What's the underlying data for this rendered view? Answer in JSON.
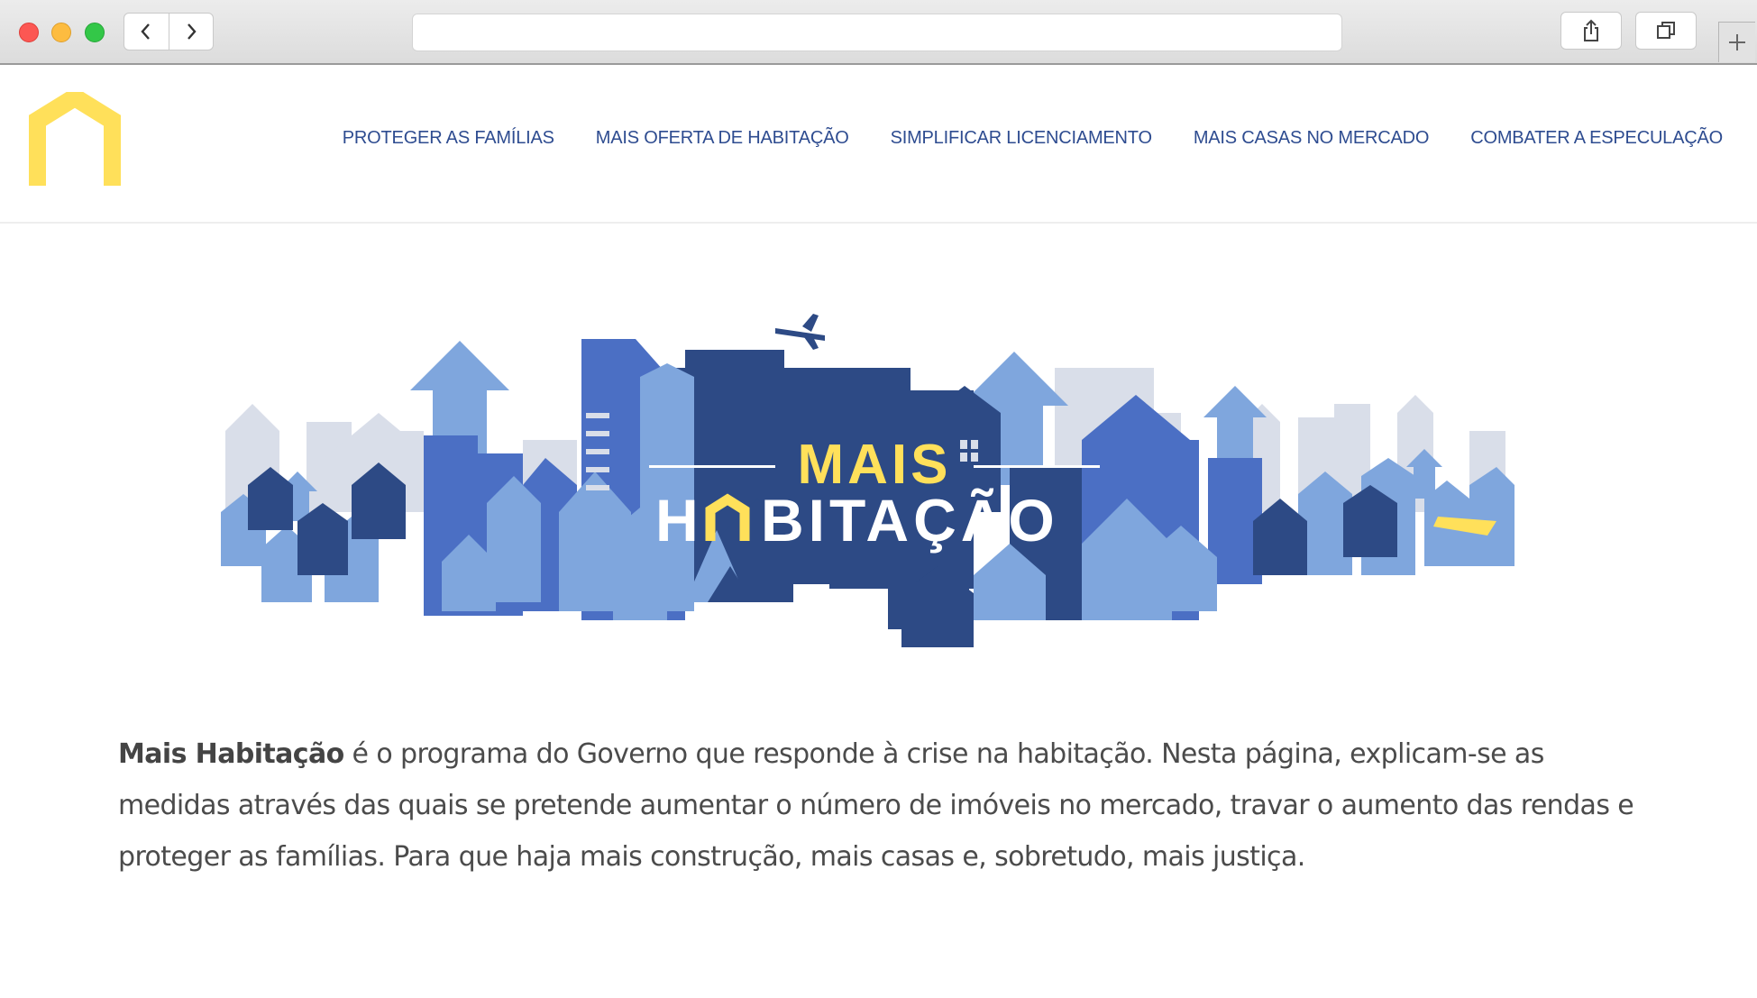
{
  "browser": {
    "url": "",
    "back_icon": "chevron-left-icon",
    "forward_icon": "chevron-right-icon",
    "share_icon": "share-icon",
    "tabs_icon": "tabs-icon",
    "new_tab_icon": "plus-icon"
  },
  "site": {
    "logo_icon": "house-outline-icon",
    "nav": [
      {
        "label": "PROTEGER AS FAMÍLIAS"
      },
      {
        "label": "MAIS OFERTA DE HABITAÇÃO"
      },
      {
        "label": "SIMPLIFICAR LICENCIAMENTO"
      },
      {
        "label": "MAIS CASAS NO MERCADO"
      },
      {
        "label": "COMBATER A ESPECULAÇÃO"
      }
    ]
  },
  "hero": {
    "title_line1": "MAIS",
    "title_line2_rest": "BITAÇÃO"
  },
  "intro": {
    "bold": "Mais Habitação",
    "text": " é o programa do Governo que responde à crise na habitação. Nesta página, explicam-se as medidas através das quais se pretende aumentar o número de imóveis no mercado, travar o aumento das rendas e proteger as famílias. Para que haja mais construção, mais casas e, sobretudo, mais justiça."
  },
  "colors": {
    "brand_yellow": "#ffe05a",
    "nav_blue": "#2e4c90",
    "dark_blue": "#2d4a85",
    "mid_blue": "#4b6fc4",
    "light_blue": "#7fa6dd",
    "pale_blue": "#d9dee9"
  }
}
